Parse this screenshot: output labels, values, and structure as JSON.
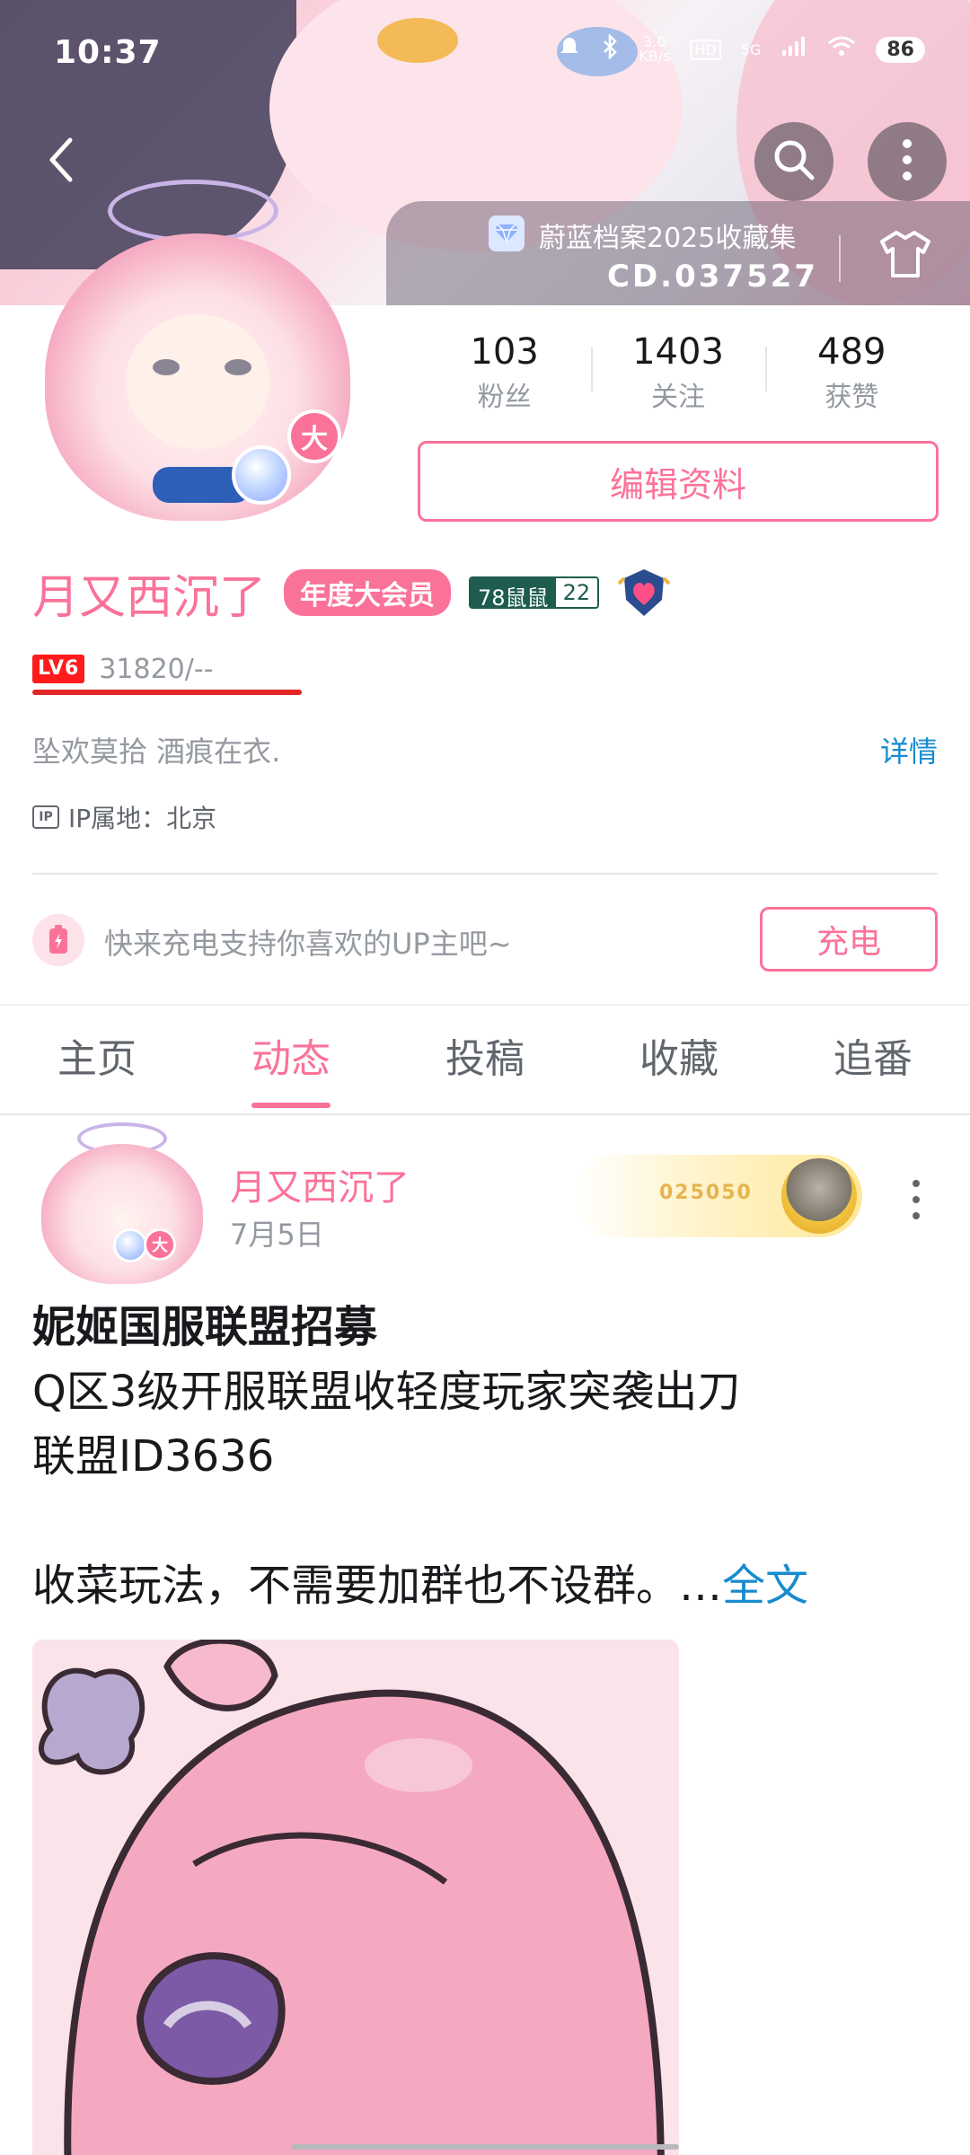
{
  "status_bar": {
    "time": "10:37",
    "network_speed_top": "3.0",
    "network_speed_unit": "KB/s",
    "hd_label": "HD",
    "signal_label": "5G",
    "battery": "86"
  },
  "banner": {
    "collection_title": "蔚蓝档案2025收藏集",
    "collection_id": "CD.037527"
  },
  "profile": {
    "avatar_vip_char": "大",
    "stats": [
      {
        "value": "103",
        "label": "粉丝"
      },
      {
        "value": "1403",
        "label": "关注"
      },
      {
        "value": "489",
        "label": "获赞"
      }
    ],
    "edit_button": "编辑资料",
    "name": "月又西沉了",
    "vip_label": "年度大会员",
    "medal_name": "78鼠鼠",
    "medal_level": "22",
    "level_badge": "LV6",
    "exp_text": "31820/--",
    "exp_progress": 1.0,
    "signature": "坠欢莫拾 酒痕在衣.",
    "detail_link": "详情",
    "ip_icon_label": "IP",
    "ip_location": "IP属地：北京"
  },
  "charge": {
    "prompt": "快来充电支持你喜欢的UP主吧~",
    "button": "充电"
  },
  "tabs": [
    {
      "label": "主页",
      "active": false
    },
    {
      "label": "动态",
      "active": true
    },
    {
      "label": "投稿",
      "active": false
    },
    {
      "label": "收藏",
      "active": false
    },
    {
      "label": "追番",
      "active": false
    }
  ],
  "post": {
    "author": "月又西沉了",
    "date": "7月5日",
    "fan_card_number": "025050",
    "lines": [
      "妮姬国服联盟招募",
      "Q区3级开服联盟收轻度玩家突袭出刀",
      "联盟ID3636",
      "",
      "收菜玩法，不需要加群也不设群。…"
    ],
    "full_text_link": "全文",
    "avatar_vip_char": "大"
  },
  "colors": {
    "accent": "#fb7299",
    "link": "#178bcf",
    "level_red": "#ff1b1b",
    "medal_green": "#1e5c4f"
  },
  "icons": {
    "back": "chevron-left-icon",
    "search": "search-icon",
    "more": "more-vertical-icon",
    "shirt": "shirt-icon",
    "charge": "battery-charge-icon",
    "ip": "ip-icon",
    "pendant": "heart-shield-icon"
  }
}
